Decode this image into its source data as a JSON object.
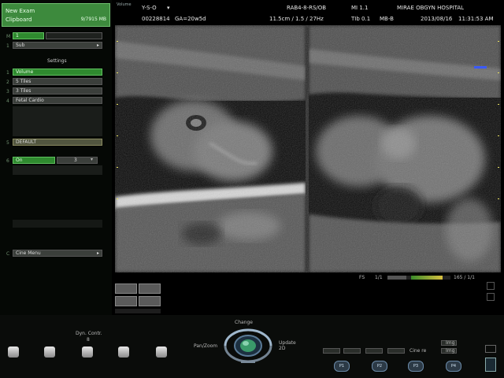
{
  "exam": {
    "title": "New Exam",
    "subtitle": "Clipboard",
    "storage": "9/7915 MB"
  },
  "header": {
    "patient": "Y-S-O",
    "exam_id": "00228814",
    "ga": "GA=20w5d",
    "probe": "RAB4-8-RS/OB",
    "mi": "MI  1.1",
    "tib": "TIb  0.1",
    "depth": "11.5cm / 1.5 / 27Hz",
    "mode": "MB-B",
    "hospital": "MIRAE OBGYN HOSPITAL",
    "date": "2013/08/16",
    "time": "11:31:53 AM",
    "volume_label": "Volume"
  },
  "left_panel": {
    "tab_label": "1",
    "sub_label": "Sub",
    "settings_title": "Settings",
    "items": [
      "Volume",
      "5 Tiles",
      "3 Tiles",
      "Fetal Cardio"
    ],
    "item_numbers": [
      "1",
      "2",
      "3",
      "4"
    ],
    "default_label": "DEFAULT",
    "default_number": "5",
    "onoff_number": "6",
    "onoff_label": "On",
    "onoff_value": "3",
    "cine_number": "C",
    "cine_label": "Cine Menu"
  },
  "fs": {
    "label": "FS",
    "left_val": "1/1",
    "right_val": "165 / 1/1"
  },
  "console": {
    "change": "Change",
    "pan_zoom": "Pan/Zoom",
    "update": "Update\n2D",
    "dyn_contr": "Dyn. Contr.",
    "dyn_value": "8",
    "p_buttons": [
      "P1",
      "P2",
      "P3",
      "P4"
    ],
    "r_labels": [
      "Img",
      "Img"
    ],
    "cine_label": "Cine re"
  },
  "colors": {
    "accent": "#2f8a2f",
    "scan_bg": "#060606"
  }
}
